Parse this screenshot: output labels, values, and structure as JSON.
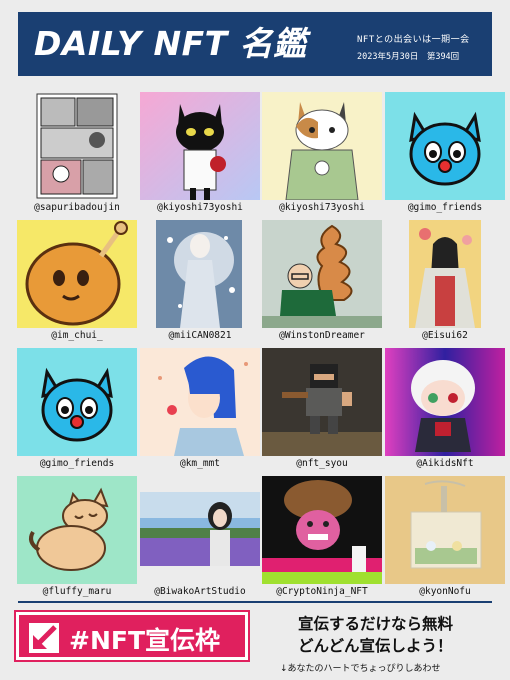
{
  "header": {
    "title": "DAILY NFT 名鑑",
    "tagline": "NFTとの出会いは一期一会",
    "date": "2023年5月30日　第394回"
  },
  "items": [
    {
      "handle": "@sapuribadoujin",
      "icon": "manga-comic-image"
    },
    {
      "handle": "@kiyoshi73yoshi",
      "icon": "black-cat-image"
    },
    {
      "handle": "@kiyoshi73yoshi",
      "icon": "calico-cat-samurai-image"
    },
    {
      "handle": "@gimo_friends",
      "icon": "blue-cat-image"
    },
    {
      "handle": "@im_chui_",
      "icon": "potato-character-image"
    },
    {
      "handle": "@miiCAN0821",
      "icon": "fantasy-angel-image"
    },
    {
      "handle": "@WinstonDreamer",
      "icon": "soft-serve-character-image"
    },
    {
      "handle": "@Eisui62",
      "icon": "japanese-painting-image"
    },
    {
      "handle": "@gimo_friends",
      "icon": "blue-cat-image"
    },
    {
      "handle": "@km_mmt",
      "icon": "blue-hair-girl-image"
    },
    {
      "handle": "@nft_syou",
      "icon": "pixel-ninja-image"
    },
    {
      "handle": "@AikidsNft",
      "icon": "chibi-character-image"
    },
    {
      "handle": "@fluffy_maru",
      "icon": "sleeping-cat-image"
    },
    {
      "handle": "@BiwakoArtStudio",
      "icon": "flower-field-portrait-image"
    },
    {
      "handle": "@CryptoNinja_NFT",
      "icon": "mushroom-ninja-image"
    },
    {
      "handle": "@kyonNofu",
      "icon": "miniature-terrarium-image"
    }
  ],
  "promo": {
    "badge": "#NFT宣伝枠",
    "line1": "宣伝するだけなら無料",
    "line2": "どんどん宣伝しよう！",
    "note": "↓あなたのハートでちょっぴりしあわせ"
  },
  "colors": {
    "header_bg": "#1a3f72",
    "promo_pink": "#e0205e",
    "page_bg": "#ececec"
  }
}
